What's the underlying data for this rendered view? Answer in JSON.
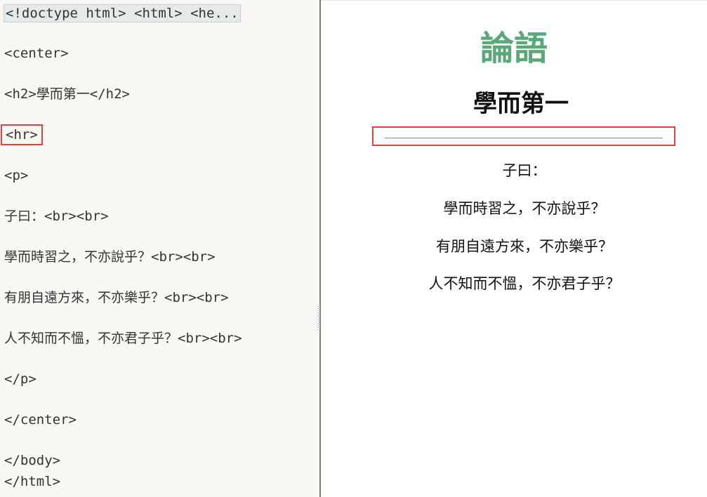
{
  "editor": {
    "lines": [
      "<!doctype html> <html> <he...",
      "<center>",
      "<h2>學而第一</h2>",
      "<hr>",
      "<p>",
      "子曰：<br><br>",
      "學而時習之，不亦說乎？<br><br>",
      "有朋自遠方來，不亦樂乎？<br><br>",
      "人不知而不慍，不亦君子乎？<br><br>",
      "</p>",
      "</center>",
      "</body>",
      "</html>"
    ]
  },
  "preview": {
    "title": "論語",
    "title_color": "#5aa878",
    "heading": "學而第一",
    "lines": [
      "子曰：",
      "學而時習之，不亦說乎？",
      "有朋自遠方來，不亦樂乎？",
      "人不知而不慍，不亦君子乎？"
    ]
  },
  "highlight_color": "#e0423f"
}
